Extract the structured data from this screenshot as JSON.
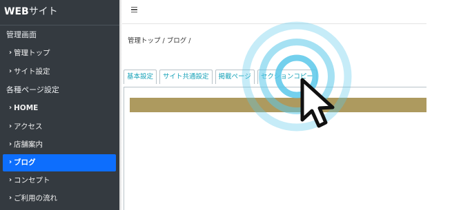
{
  "brand": {
    "bold": "WEB",
    "rest": "サイト"
  },
  "sidebar": {
    "section1": "管理画面",
    "group1": [
      {
        "label": "管理トップ"
      },
      {
        "label": "サイト設定"
      }
    ],
    "section2": "各種ページ設定",
    "group2": [
      {
        "label": "HOME"
      },
      {
        "label": "アクセス"
      },
      {
        "label": "店舗案内"
      },
      {
        "label": "ブログ"
      },
      {
        "label": "コンセプト"
      },
      {
        "label": "ご利用の流れ"
      }
    ]
  },
  "breadcrumb": "管理トップ / ブログ /",
  "tabs": [
    "基本設定",
    "サイト共通設定",
    "掲載ページ",
    "セクションコピー"
  ],
  "colors": {
    "sidebar_bg": "#343a40",
    "active_bg": "#0d6efd",
    "tab_text": "#17a2b8",
    "gold_bar": "#ad9a5f",
    "ripple": "#5bc8ea"
  },
  "icons": {
    "menu": "hamburger-icon",
    "chevron": "chevron-right-icon",
    "cursor": "mouse-pointer-icon"
  }
}
